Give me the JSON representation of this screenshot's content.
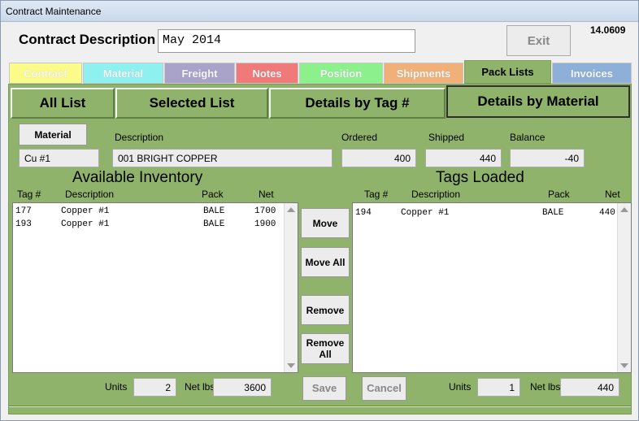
{
  "window": {
    "title": "Contract Maintenance",
    "version": "14.0609"
  },
  "header": {
    "contract_description_label": "Contract Description",
    "contract_description_value": "May 2014",
    "exit_label": "Exit"
  },
  "tabs": [
    {
      "label": "Contract",
      "color": "#fbfb8a"
    },
    {
      "label": "Material",
      "color": "#8ff0f0"
    },
    {
      "label": "Freight",
      "color": "#a9a2c9"
    },
    {
      "label": "Notes",
      "color": "#f07a7a"
    },
    {
      "label": "Position",
      "color": "#8cf08c"
    },
    {
      "label": "Shipments",
      "color": "#f0b078"
    },
    {
      "label": "Pack Lists",
      "color": "#8fb36a"
    },
    {
      "label": "Invoices",
      "color": "#8eb0d8"
    }
  ],
  "subtabs": [
    "All List",
    "Selected List",
    "Details by Tag #",
    "Details by Material"
  ],
  "material": {
    "button_label": "Material",
    "code": "Cu #1",
    "description_label": "Description",
    "description": "001 BRIGHT COPPER",
    "ordered_label": "Ordered",
    "ordered": "400",
    "shipped_label": "Shipped",
    "shipped": "440",
    "balance_label": "Balance",
    "balance": "-40"
  },
  "available": {
    "title": "Available Inventory",
    "columns": {
      "tag": "Tag #",
      "description": "Description",
      "pack": "Pack",
      "net": "Net"
    },
    "rows": [
      {
        "tag": "177",
        "description": "Copper #1",
        "pack": "BALE",
        "net": "1700"
      },
      {
        "tag": "193",
        "description": "Copper #1",
        "pack": "BALE",
        "net": "1900"
      }
    ],
    "units_label": "Units",
    "units": "2",
    "netlbs_label": "Net lbs",
    "netlbs": "3600"
  },
  "loaded": {
    "title": "Tags Loaded",
    "columns": {
      "tag": "Tag #",
      "description": "Description",
      "pack": "Pack",
      "net": "Net"
    },
    "rows": [
      {
        "tag": "194",
        "description": "Copper #1",
        "pack": "BALE",
        "net": "440"
      }
    ],
    "units_label": "Units",
    "units": "1",
    "netlbs_label": "Net lbs",
    "netlbs": "440"
  },
  "actions": {
    "move": "Move",
    "move_all": "Move All",
    "remove": "Remove",
    "remove_all_line1": "Remove",
    "remove_all_line2": "All",
    "save": "Save",
    "cancel": "Cancel"
  }
}
